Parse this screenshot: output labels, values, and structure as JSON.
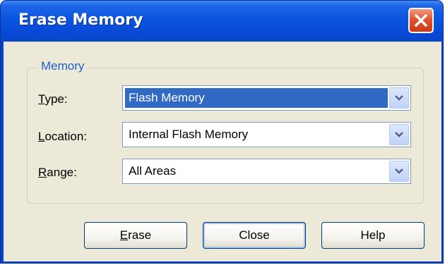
{
  "dialog": {
    "title": "Erase Memory"
  },
  "memory_group": {
    "label": "Memory",
    "fields": [
      {
        "label_mnemonic": "T",
        "label_rest": "ype:",
        "value": "Flash Memory"
      },
      {
        "label_mnemonic": "L",
        "label_rest": "ocation:",
        "value": "Internal Flash Memory"
      },
      {
        "label_mnemonic": "R",
        "label_rest": "ange:",
        "value": "All Areas"
      }
    ]
  },
  "buttons": {
    "erase_mnemonic": "E",
    "erase_rest": "rase",
    "close": "Close",
    "help": "Help"
  },
  "icons": {
    "close": "close-icon",
    "dropdown": "chevron-down-icon"
  },
  "colors": {
    "titlebar": "#0a55e0",
    "close_button": "#e0542f",
    "selection": "#316ac5",
    "group_label": "#1f5fcf",
    "dialog_face": "#ece9d8"
  }
}
